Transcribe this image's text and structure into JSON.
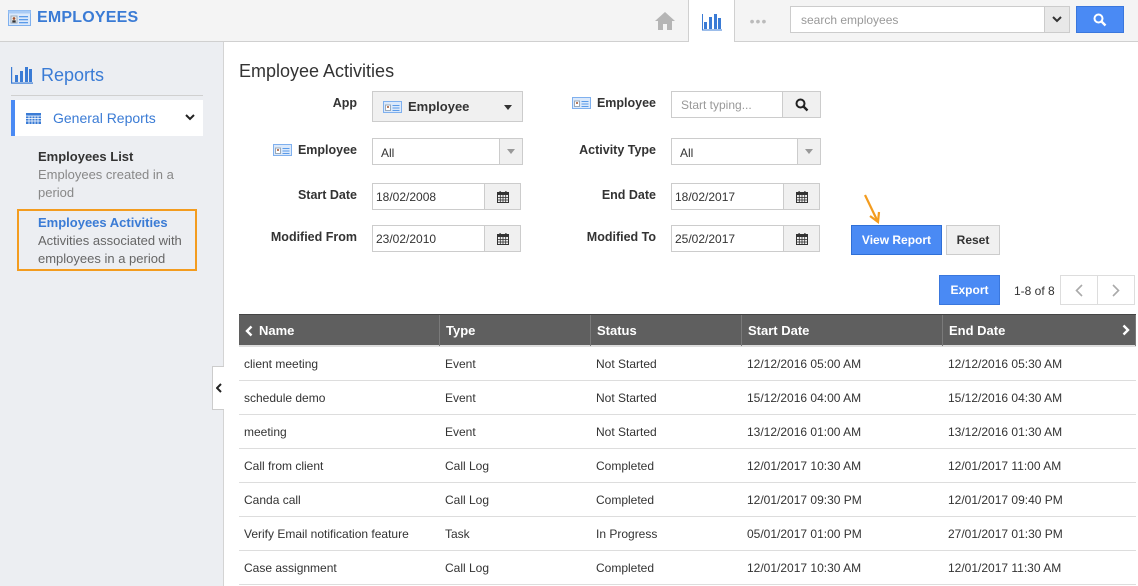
{
  "header": {
    "app_title": "EMPLOYEES",
    "app_icon": "employee-card-icon",
    "nav": [
      {
        "name": "home",
        "icon": "home-icon"
      },
      {
        "name": "reports",
        "icon": "bar-chart-icon",
        "active": true
      },
      {
        "name": "more",
        "icon": "more-dots-icon",
        "label": "•••"
      }
    ],
    "search": {
      "placeholder": "search employees",
      "value": ""
    },
    "search_button_icon": "search-icon",
    "accent_color": "#4a8af4"
  },
  "sidebar": {
    "heading": "Reports",
    "group": {
      "label": "General Reports",
      "icon": "grid-icon",
      "expanded": true
    },
    "items": [
      {
        "title": "Employees List",
        "description": "Employees created in a period",
        "active": false
      },
      {
        "title": "Employees Activities",
        "description": "Activities associated with employees in a period",
        "active": true
      }
    ],
    "highlight_color": "#f39c1f"
  },
  "main": {
    "title": "Employee Activities",
    "filters": {
      "app": {
        "label": "App",
        "value": "Employee"
      },
      "employee_lookup": {
        "label": "Employee",
        "placeholder": "Start typing...",
        "value": ""
      },
      "employee": {
        "label": "Employee",
        "value": "All"
      },
      "activity_type": {
        "label": "Activity Type",
        "value": "All"
      },
      "start_date": {
        "label": "Start Date",
        "value": "18/02/2008"
      },
      "end_date": {
        "label": "End Date",
        "value": "18/02/2017"
      },
      "modified_from": {
        "label": "Modified From",
        "value": "23/02/2010"
      },
      "modified_to": {
        "label": "Modified To",
        "value": "25/02/2017"
      }
    },
    "buttons": {
      "view_report": "View Report",
      "reset": "Reset",
      "export": "Export"
    },
    "pager": {
      "text": "1-8 of 8"
    },
    "table": {
      "columns": [
        "Name",
        "Type",
        "Status",
        "Start Date",
        "End Date"
      ],
      "rows": [
        [
          "client meeting",
          "Event",
          "Not Started",
          "12/12/2016 05:00 AM",
          "12/12/2016 05:30 AM"
        ],
        [
          "schedule demo",
          "Event",
          "Not Started",
          "15/12/2016 04:00 AM",
          "15/12/2016 04:30 AM"
        ],
        [
          "meeting",
          "Event",
          "Not Started",
          "13/12/2016 01:00 AM",
          "13/12/2016 01:30 AM"
        ],
        [
          "Call from client",
          "Call Log",
          "Completed",
          "12/01/2017 10:30 AM",
          "12/01/2017 11:00 AM"
        ],
        [
          "Canda call",
          "Call Log",
          "Completed",
          "12/01/2017 09:30 PM",
          "12/01/2017 09:40 PM"
        ],
        [
          "Verify Email notification feature",
          "Task",
          "In Progress",
          "05/01/2017 01:00 PM",
          "27/01/2017 01:30 PM"
        ],
        [
          "Case assignment",
          "Call Log",
          "Completed",
          "12/01/2017 10:30 AM",
          "12/01/2017 11:30 AM"
        ]
      ]
    }
  }
}
